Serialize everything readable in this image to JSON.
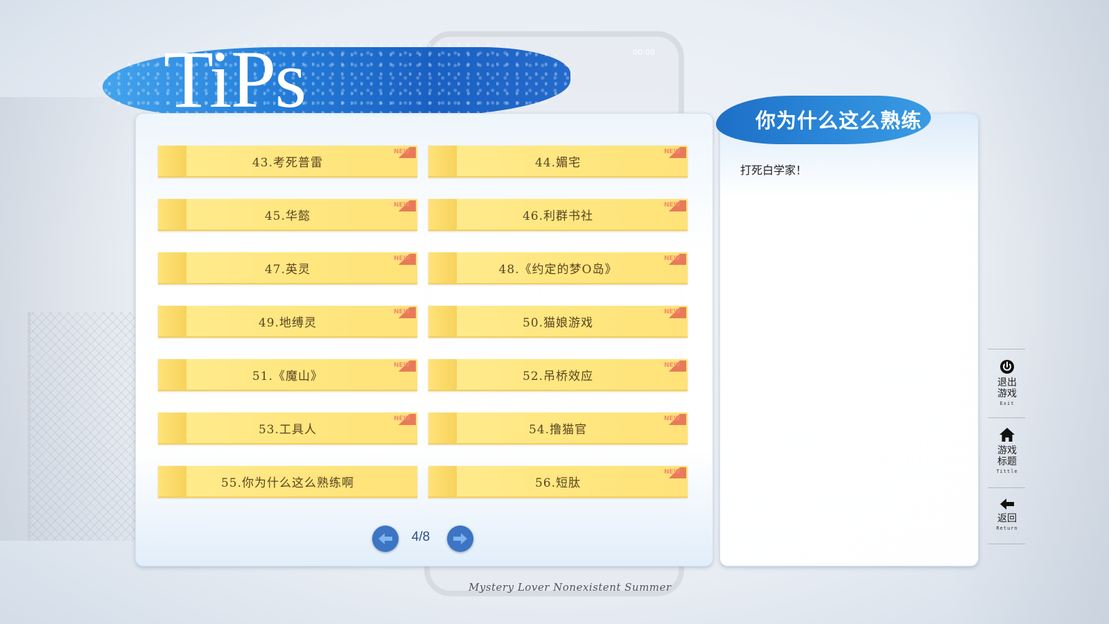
{
  "header": {
    "title": "TiPs"
  },
  "phone": {
    "time": "00:00"
  },
  "tips": {
    "items": [
      {
        "label": "43.考死普雷",
        "is_new": true
      },
      {
        "label": "44.媚宅",
        "is_new": true
      },
      {
        "label": "45.华懿",
        "is_new": true
      },
      {
        "label": "46.利群书社",
        "is_new": true
      },
      {
        "label": "47.英灵",
        "is_new": true
      },
      {
        "label": "48.《约定的梦O岛》",
        "is_new": true
      },
      {
        "label": "49.地缚灵",
        "is_new": true
      },
      {
        "label": "50.猫娘游戏",
        "is_new": true
      },
      {
        "label": "51.《魔山》",
        "is_new": true
      },
      {
        "label": "52.吊桥效应",
        "is_new": true
      },
      {
        "label": "53.工具人",
        "is_new": true
      },
      {
        "label": "54.撸猫官",
        "is_new": true
      },
      {
        "label": "55.你为什么这么熟练啊",
        "is_new": false
      },
      {
        "label": "56.短肽",
        "is_new": true
      }
    ],
    "new_badge": "NEW"
  },
  "pager": {
    "indicator": "4/8",
    "current_page": 4,
    "total_pages": 8
  },
  "detail": {
    "title": "你为什么这么熟练",
    "body": "打死白学家！"
  },
  "side_menu": {
    "exit": {
      "label_line1": "退出",
      "label_line2": "游戏",
      "sub": "Exit",
      "icon": "power-icon"
    },
    "title": {
      "label_line1": "游戏",
      "label_line2": "标题",
      "sub": "Tittle",
      "icon": "home-icon"
    },
    "return": {
      "label": "返回",
      "sub": "Return",
      "icon": "back-arrow-icon"
    }
  },
  "footer": {
    "signature": "Mystery Lover Nonexistent Summer"
  },
  "colors": {
    "accent_blue": "#2c7ed1",
    "note_yellow": "#ffe67e",
    "pager_blue": "#3d74c3",
    "new_red": "#e87a5a"
  }
}
